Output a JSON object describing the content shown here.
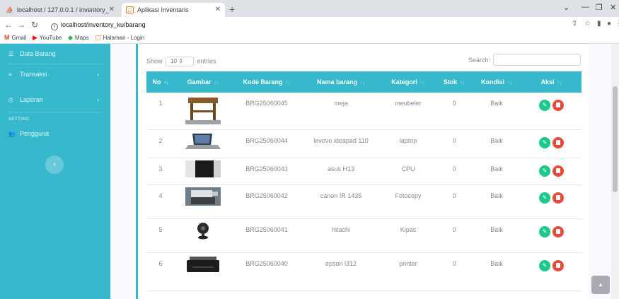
{
  "browser": {
    "tabs": [
      {
        "title": "localhost / 127.0.0.1 / inventory_",
        "close": "✕"
      },
      {
        "title": "Aplikasi Inventaris",
        "close": "✕"
      }
    ],
    "new_tab": "+",
    "url": "localhost/inventory_ku/barang",
    "bookmarks": [
      "Gmail",
      "YouTube",
      "Maps",
      "Halaman - Login"
    ]
  },
  "sidebar": {
    "items": [
      {
        "label": "Data Barang",
        "icon": "table-icon"
      },
      {
        "label": "Transaksi",
        "icon": "list-icon"
      },
      {
        "label": "Laporan",
        "icon": "print-icon"
      },
      {
        "label": "Pengguna",
        "icon": "users-icon"
      }
    ],
    "heading": "SETTING",
    "chevron": "›",
    "toggle": "‹"
  },
  "datatable": {
    "show_label": "Show",
    "entries_value": "10",
    "entries_label": "entries",
    "search_label": "Search:",
    "columns": [
      "No",
      "Gambar",
      "Kode Barang",
      "Nama barang",
      "Kategori",
      "Stok",
      "Kondisi",
      "Aksi"
    ],
    "rows": [
      {
        "no": "1",
        "kode": "BRG25060045",
        "nama": "meja",
        "kategori": "meubeler",
        "stok": "0",
        "kondisi": "Baik",
        "img": "table"
      },
      {
        "no": "2",
        "kode": "BRG25060044",
        "nama": "levovo ideapad 110",
        "kategori": "laptop",
        "stok": "0",
        "kondisi": "Baik",
        "img": "laptop"
      },
      {
        "no": "3",
        "kode": "BRG25060043",
        "nama": "asus H13",
        "kategori": "CPU",
        "stok": "0",
        "kondisi": "Baik",
        "img": "cpu"
      },
      {
        "no": "4",
        "kode": "BRG25060042",
        "nama": "canon IR 1435",
        "kategori": "Fotocopy",
        "stok": "0",
        "kondisi": "Baik",
        "img": "copier"
      },
      {
        "no": "5",
        "kode": "BRG25060041",
        "nama": "hitachi",
        "kategori": "Kipas",
        "stok": "0",
        "kondisi": "Baik",
        "img": "fan"
      },
      {
        "no": "6",
        "kode": "BRG25060040",
        "nama": "epson l312",
        "kategori": "printer",
        "stok": "0",
        "kondisi": "Baik",
        "img": "printer"
      }
    ]
  },
  "colors": {
    "primary": "#36b9cc",
    "edit": "#1cc88a",
    "delete": "#e74a3b"
  }
}
